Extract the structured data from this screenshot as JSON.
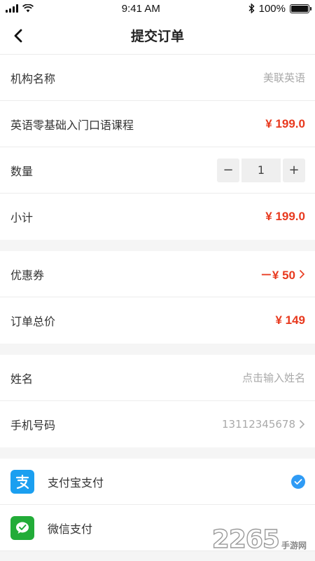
{
  "status_bar": {
    "time": "9:41 AM",
    "battery": "100%",
    "battery_level": 1.0
  },
  "nav": {
    "title": "提交订单",
    "back_icon": "chevron-left-icon"
  },
  "order": {
    "institution_label": "机构名称",
    "institution_value": "美联英语",
    "course_name": "英语零基础入门口语课程",
    "course_price": "¥ 199.0",
    "quantity_label": "数量",
    "quantity_minus": "−",
    "quantity_value": "1",
    "quantity_plus": "+",
    "subtotal_label": "小计",
    "subtotal_value": "¥ 199.0"
  },
  "discount": {
    "coupon_label": "优惠券",
    "coupon_value": "－¥ 50",
    "total_label": "订单总价",
    "total_value": "¥ 149"
  },
  "contact": {
    "name_label": "姓名",
    "name_placeholder": "点击输入姓名",
    "phone_label": "手机号码",
    "phone_value": "13112345678"
  },
  "payment": {
    "alipay_label": "支付宝支付",
    "alipay_icon": "alipay-icon",
    "wechat_label": "微信支付",
    "wechat_icon": "wechat-pay-icon",
    "selected": "alipay"
  },
  "watermark": {
    "number": "2265",
    "text": "手游网"
  },
  "colors": {
    "price": "#e8391e",
    "alipay": "#1b9ff0",
    "wechat": "#22ac38",
    "check": "#2f9bf5"
  }
}
